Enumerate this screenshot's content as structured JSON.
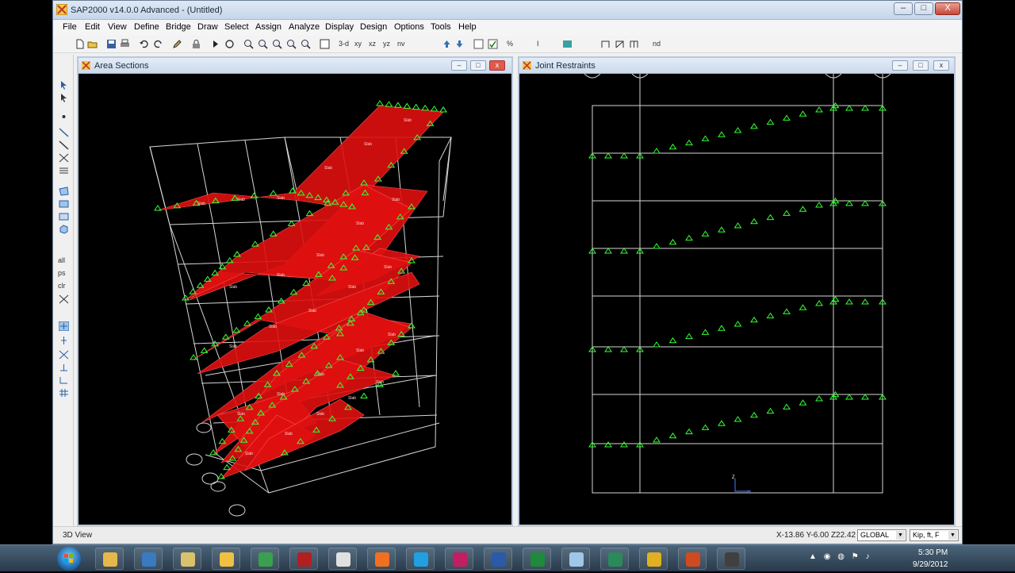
{
  "app": {
    "title": "SAP2000 v14.0.0 Advanced  - (Untitled)",
    "window_buttons": {
      "minimize": "–",
      "maximize": "□",
      "close": "X"
    }
  },
  "menu": [
    "File",
    "Edit",
    "View",
    "Define",
    "Bridge",
    "Draw",
    "Select",
    "Assign",
    "Analyze",
    "Display",
    "Design",
    "Options",
    "Tools",
    "Help"
  ],
  "toolbar": {
    "view_labels": [
      "3-d",
      "xy",
      "xz",
      "yz",
      "nv"
    ],
    "nd_label": "nd"
  },
  "left_tools": {
    "labels": [
      "all",
      "ps",
      "clr"
    ]
  },
  "windows": {
    "left": {
      "title": "Area Sections",
      "area_label": "Slab"
    },
    "right": {
      "title": "Joint Restraints"
    }
  },
  "status": {
    "view": "3D View",
    "coords": "X-13.86  Y-6.00  Z22.42",
    "coord_system": "GLOBAL",
    "units": "Kip, ft, F"
  },
  "taskbar": {
    "time": "5:30 PM",
    "date": "9/29/2012",
    "apps": [
      "explorer",
      "media-player",
      "folder",
      "world-clock",
      "network",
      "filezilla",
      "chrome",
      "firefox",
      "skype",
      "winrar",
      "word",
      "excel",
      "notepad",
      "media-center",
      "sap2000",
      "powerpoint",
      "camtasia"
    ]
  },
  "colors": {
    "slab": "#e01010",
    "frame": "#d8d8d8",
    "support": "#33ff33",
    "accent": "#1f6fb5"
  }
}
